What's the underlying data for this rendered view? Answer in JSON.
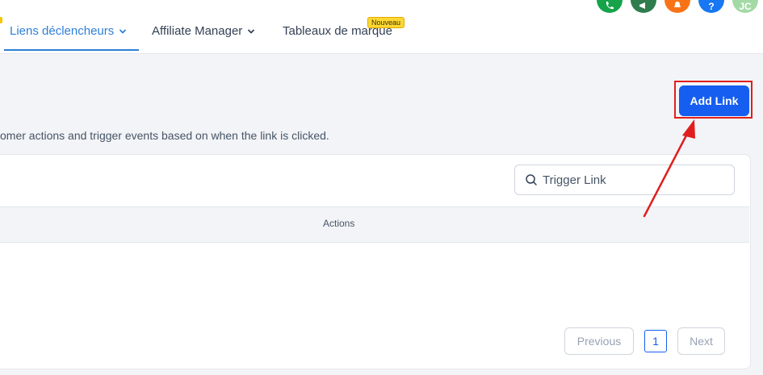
{
  "nav": {
    "tabs": [
      {
        "label": "Liens déclencheurs",
        "active": true,
        "has_dropdown": true
      },
      {
        "label": "Affiliate Manager",
        "active": false,
        "has_dropdown": true
      },
      {
        "label": "Tableaux de marque",
        "active": false,
        "has_dropdown": false,
        "badge": "Nouveau"
      }
    ],
    "header_icons": [
      {
        "name": "phone-icon",
        "color": "#16a34a"
      },
      {
        "name": "megaphone-icon",
        "color": "#2f7d4f"
      },
      {
        "name": "bell-icon",
        "color": "#f97316"
      },
      {
        "name": "help-icon",
        "color": "#1877f2"
      },
      {
        "name": "avatar",
        "color": "#a3d9a5",
        "text": "JC"
      }
    ]
  },
  "page": {
    "add_button_label": "Add Link",
    "description": "omer actions and trigger events based on when the link is clicked."
  },
  "table": {
    "search_placeholder": "Trigger Link",
    "columns": [
      "Actions"
    ],
    "rows": []
  },
  "pagination": {
    "previous_label": "Previous",
    "current_page": "1",
    "next_label": "Next"
  },
  "annotation": {
    "highlight_color": "#e01e1e"
  }
}
